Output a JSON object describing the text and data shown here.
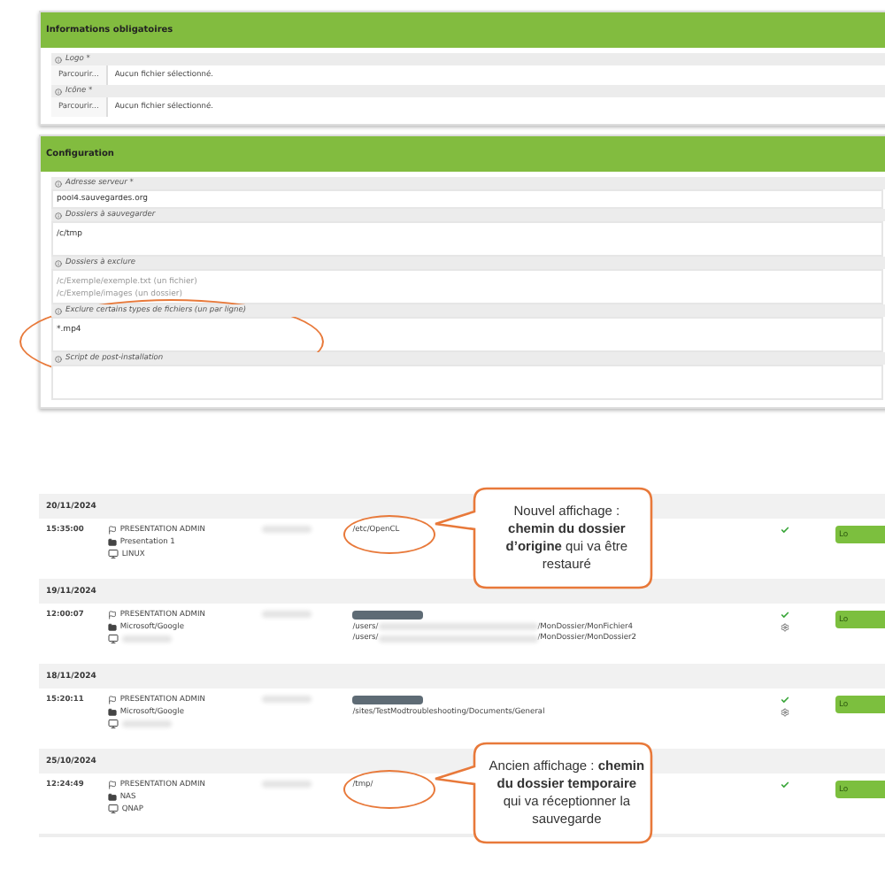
{
  "panels": [
    {
      "title": "Informations obligatoires",
      "fields": [
        {
          "label": "Logo *",
          "kind": "file",
          "button": "Parcourir...",
          "value": "Aucun fichier sélectionné."
        },
        {
          "label": "Icône *",
          "kind": "file",
          "button": "Parcourir...",
          "value": "Aucun fichier sélectionné."
        }
      ]
    },
    {
      "title": "Configuration",
      "fields": [
        {
          "label": "Adresse serveur *",
          "kind": "text",
          "value": "pool4.sauvegardes.org"
        },
        {
          "label": "Dossiers à sauvegarder",
          "kind": "textarea",
          "value": "/c/tmp"
        },
        {
          "label": "Dossiers à exclure",
          "kind": "textarea",
          "placeholder": "/c/Exemple/exemple.txt (un fichier)\n/c/Exemple/images (un dossier)"
        },
        {
          "label": "Exclure certains types de fichiers (un par ligne)",
          "kind": "textarea",
          "value": "*.mp4",
          "highlighted": true
        },
        {
          "label": "Script de post-installation",
          "kind": "textarea"
        }
      ]
    }
  ],
  "backups": [
    {
      "date": "20/11/2024",
      "entries": [
        {
          "time": "15:35:00",
          "user": "PRESENTATION ADMIN",
          "folder": "Presentation 1",
          "machine": "LINUX",
          "badge": false,
          "paths": [
            {
              "start": "/etc/OpenCL"
            }
          ],
          "highlighted": true,
          "callout": "Nouvel affichage : **chemin du dossier d’origine** qui va être restauré",
          "status": [
            {
              "kind": "ok"
            }
          ],
          "action": "Lo"
        }
      ]
    },
    {
      "date": "19/11/2024",
      "entries": [
        {
          "time": "12:00:07",
          "user": "PRESENTATION ADMIN",
          "folder": "Microsoft/Google",
          "badge": true,
          "paths": [
            {
              "start": "/users/",
              "end": "/MonDossier/MonFichier4"
            },
            {
              "start": "/users/",
              "end": "/MonDossier/MonDossier2"
            }
          ],
          "highlighted": false,
          "status": [
            {
              "kind": "ok"
            },
            {
              "kind": "gear"
            }
          ],
          "action": "Lo"
        }
      ]
    },
    {
      "date": "18/11/2024",
      "entries": [
        {
          "time": "15:20:11",
          "user": "PRESENTATION ADMIN",
          "folder": "Microsoft/Google",
          "badge": true,
          "paths": [
            {
              "start": "/sites/TestModtroubleshooting/Documents/General"
            }
          ],
          "highlighted": false,
          "status": [
            {
              "kind": "ok"
            },
            {
              "kind": "gear"
            }
          ],
          "action": "Lo"
        }
      ]
    },
    {
      "date": "25/10/2024",
      "entries": [
        {
          "time": "12:24:49",
          "user": "PRESENTATION ADMIN",
          "folder": "NAS",
          "machine": "QNAP",
          "badge": false,
          "paths": [
            {
              "start": "/tmp/"
            }
          ],
          "highlighted": true,
          "callout": "Ancien affichage : **chemin du dossier temporaire** qui va réceptionner la sauvegarde",
          "status": [
            {
              "kind": "ok"
            }
          ],
          "action": "Lo"
        }
      ]
    }
  ]
}
